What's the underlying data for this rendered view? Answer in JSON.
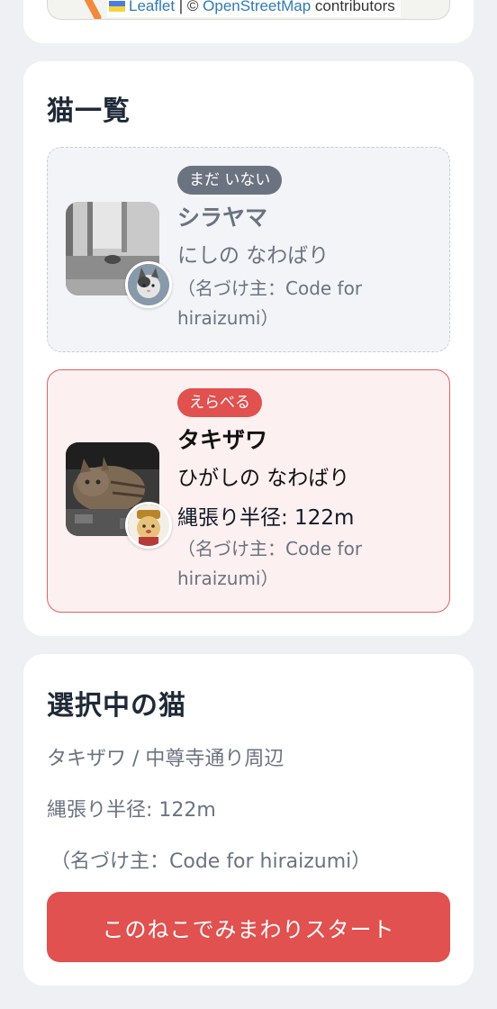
{
  "map": {
    "attribution": {
      "leaflet": "Leaflet",
      "separator": " | © ",
      "osm": "OpenStreetMap",
      "suffix": " contributors"
    }
  },
  "cat_list": {
    "title": "猫一覧",
    "items": [
      {
        "badge": "まだ いない",
        "name": "シラヤマ",
        "area": "にしの なわばり",
        "radius": "",
        "namer": "（名づけ主：Code for hiraizumi）",
        "state": "inactive"
      },
      {
        "badge": "えらべる",
        "name": "タキザワ",
        "area": "ひがしの なわばり",
        "radius": "縄張り半径: 122m",
        "namer": "（名づけ主：Code for hiraizumi）",
        "state": "selected"
      }
    ]
  },
  "selected_cat": {
    "title": "選択中の猫",
    "location": "タキザワ / 中尊寺通り周辺",
    "radius": "縄張り半径: 122m",
    "namer": "（名づけ主：Code for hiraizumi）",
    "start_label": "このねこでみまわりスタート"
  },
  "colors": {
    "accent": "#e0514f",
    "muted_badge": "#6b7280",
    "selected_bg": "#fdf0f0",
    "inactive_bg": "#f2f4f7"
  }
}
